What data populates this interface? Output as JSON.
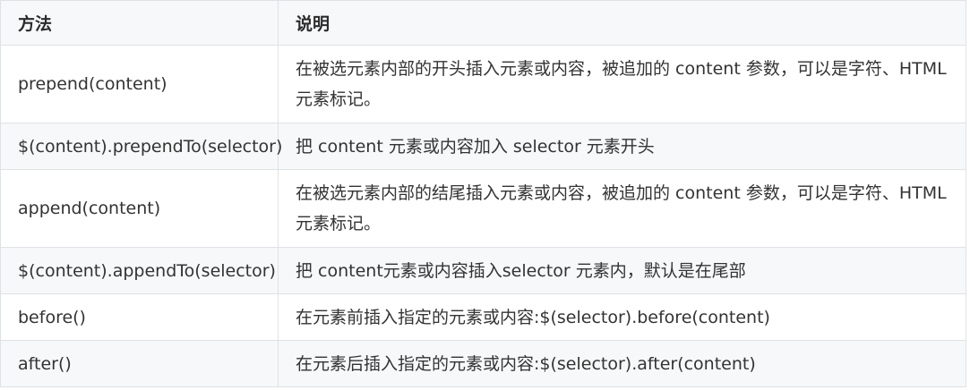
{
  "table": {
    "headers": [
      "方法",
      "说明"
    ],
    "rows": [
      {
        "method": "prepend(content)",
        "desc": "在被选元素内部的开头插入元素或内容，被追加的 content 参数，可以是字符、HTML 元素标记。"
      },
      {
        "method": "$(content).prependTo(selector)",
        "desc": "把 content 元素或内容加入 selector 元素开头"
      },
      {
        "method": "append(content)",
        "desc": "在被选元素内部的结尾插入元素或内容，被追加的 content 参数，可以是字符、HTML 元素标记。"
      },
      {
        "method": "$(content).appendTo(selector)",
        "desc": "把 content元素或内容插入selector 元素内，默认是在尾部"
      },
      {
        "method": "before()",
        "desc": "在元素前插入指定的元素或内容:$(selector).before(content)"
      },
      {
        "method": "after()",
        "desc": "在元素后插入指定的元素或内容:$(selector).after(content)"
      }
    ]
  }
}
